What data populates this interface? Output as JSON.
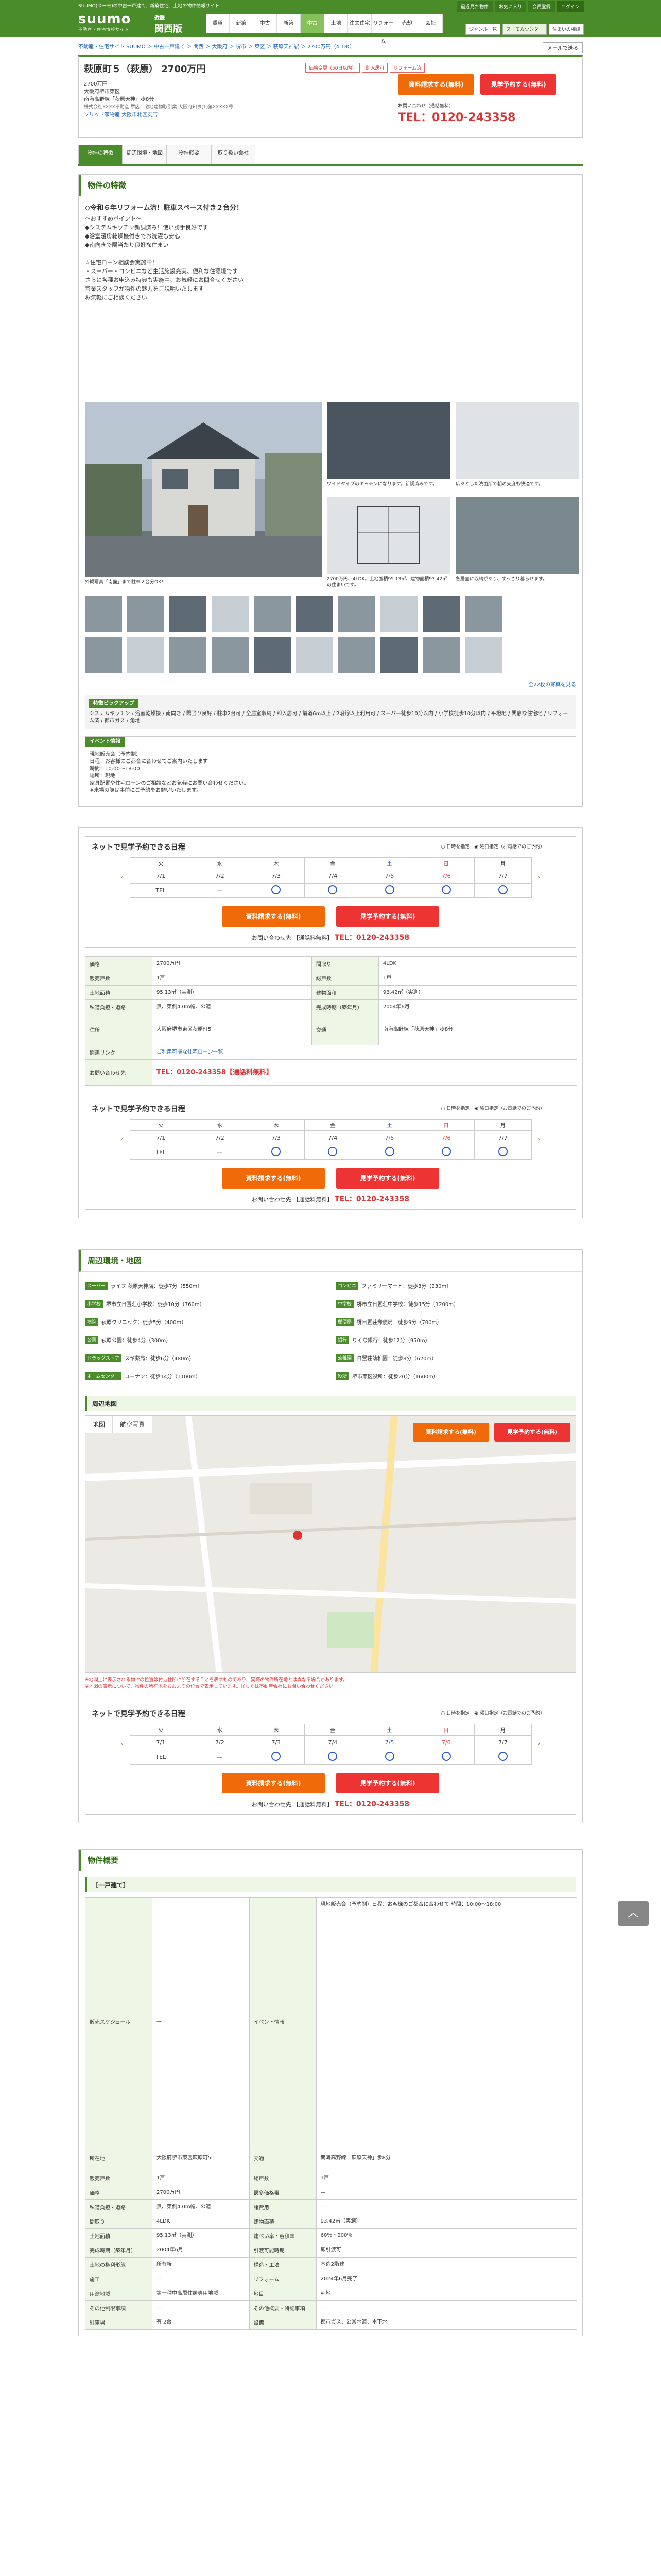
{
  "header": {
    "tagline": "SUUMO(スーモ)の中古一戸建て、新築住宅、土地の物件情報サイト",
    "logo": "suumo",
    "logo_sub": "不動産・住宅情報サイト",
    "region_label": "近畿",
    "region": "関西版",
    "links": [
      "最近見た物件",
      "お気に入り",
      "会員登録",
      "ログイン"
    ],
    "nav": [
      "賃貸",
      "新築マンション",
      "中古マンション",
      "新築一戸建て",
      "中古一戸建て",
      "土地",
      "注文住宅",
      "リフォーム",
      "売却査定",
      "不動産会社"
    ],
    "nav_short": [
      "賃貸",
      "新築",
      "中古",
      "新築",
      "中古",
      "土地",
      "注文住宅",
      "リフォーム",
      "売却",
      "会社"
    ],
    "nav_active": 4,
    "right_links": [
      "ジャンル一覧",
      "スーモカウンター",
      "住まいの相談"
    ]
  },
  "breadcrumb": "不動産・住宅サイト SUUMO ＞ 中古一戸建て ＞ 関西 ＞ 大阪府 ＞ 堺市 ＞ 東区 ＞ 萩原天神駅 ＞ 2700万円（4LDK）",
  "mail_button": "メールで送る",
  "property": {
    "title": "萩原町５（萩原） 2700万円",
    "labels": [
      "価格変更（50日以内）",
      "即入居可",
      "リフォーム済"
    ],
    "price": "2700万円",
    "address": "大阪府堺市東区",
    "station": "南海高野線「萩原天神」歩8分",
    "company_line": "株式会社XXXX不動産 堺店　宅地建物取引業 大阪府知事(1)第XXXXX号",
    "company_link": "ソリッド家物産 大阪市北区支店",
    "req_button": "資料請求する(無料)",
    "visit_button": "見学予約する(無料)",
    "tel_note": "お問い合わせ（通話無料）",
    "tel": "TEL：0120-243358"
  },
  "tabs": [
    "物件の特徴",
    "周辺環境・地図",
    "物件概要",
    "取り扱い会社"
  ],
  "feature": {
    "heading": "物件の特徴",
    "catch": "◇令和６年リフォーム済！駐車スペース付き２台分！",
    "lines": [
      "～おすすめポイント～",
      "◆システムキッチン新調済み！使い勝手良好です",
      "◆浴室暖房乾燥機付きでお洗濯も安心",
      "◆南向きで陽当たり良好な住まい",
      "",
      "☆住宅ローン相談会実施中！",
      "・スーパー・コンビニなど生活施設充実、便利な住環境です",
      "さらに各種お申込み特典も実施中。お気軽にお問合せください",
      "営業スタッフが物件の魅力をご説明いたします",
      "お気軽にご相談ください"
    ]
  },
  "gallery": {
    "caps": [
      "外観写真「南面」まで駐車２台分OK！",
      "ワイドタイプのキッチンになります。新調済みです。",
      "広々とした洗面所で朝の支度も快適です。",
      "2700万円、4LDK。土地面積95.13㎡、建物面積93.42㎡の住まいです。",
      "各居室に収納があり、すっきり暮らせます。"
    ],
    "more": "全22枚の写真を見る"
  },
  "pickup": {
    "label": "特徴ピックアップ",
    "text": "システムキッチン / 浴室乾燥機 / 南向き / 陽当り良好 / 駐車2台可 / 全居室収納 / 即入居可 / 前道6m以上 / 2沿線以上利用可 / スーパー徒歩10分以内 / 小学校徒歩10分以内 / 平坦地 / 閑静な住宅地 / リフォーム済 / 都市ガス / 角地"
  },
  "event": {
    "label": "イベント情報",
    "lines": [
      "現地販売会（予約制）",
      "日程：お客様のご都合に合わせてご案内いたします",
      "時間：10:00～18:00",
      "場所：現地",
      "家具配置や住宅ローンのご相談などお気軽にお問い合わせください。",
      "※来場の際は事前にご予約をお願いいたします。"
    ]
  },
  "calendar": {
    "title": "ネットで見学予約できる日程",
    "radio1": "日時を指定",
    "radio2": "曜日指定（お電話でのご予約）",
    "dows": [
      "火",
      "水",
      "木",
      "金",
      "土",
      "日",
      "月"
    ],
    "dates": [
      "7/1",
      "7/2",
      "7/3",
      "7/4",
      "7/5",
      "7/6",
      "7/7"
    ],
    "tel_label": "TEL",
    "dash": "—",
    "req_button": "資料請求する(無料)",
    "visit_button": "見学予約する(無料)",
    "tel_text": "お問い合わせ先",
    "tel_label2": "【通話料無料】",
    "tel": "TEL：0120-243358"
  },
  "summary_rows": [
    [
      "価格",
      "2700万円",
      "間取り",
      "4LDK"
    ],
    [
      "販売戸数",
      "1戸",
      "総戸数",
      "1戸"
    ],
    [
      "土地面積",
      "95.13㎡（実測）",
      "建物面積",
      "93.42㎡（実測）"
    ],
    [
      "私道負担・道路",
      "無、東側4.0m幅、公道",
      "完成時期（築年月）",
      "2004年6月"
    ],
    [
      "住所",
      "大阪府堺市東区萩原町5",
      "交通",
      "南海高野線「萩原天神」歩8分"
    ],
    [
      "関連リンク",
      "ご利用可能な住宅ローン一覧",
      "",
      ""
    ],
    [
      "お問い合わせ先",
      "TEL：0120-243358【通話料無料】",
      "",
      ""
    ]
  ],
  "surroundings": {
    "heading": "周辺環境・地図",
    "items": [
      [
        "スーパー",
        "ライフ 萩原天神店：徒歩7分（550m）"
      ],
      [
        "コンビニ",
        "ファミリーマート：徒歩3分（230m）"
      ],
      [
        "小学校",
        "堺市立日置荘小学校：徒歩10分（760m）"
      ],
      [
        "中学校",
        "堺市立日置荘中学校：徒歩15分（1200m）"
      ],
      [
        "病院",
        "萩原クリニック：徒歩5分（400m）"
      ],
      [
        "郵便局",
        "堺日置荘郵便局：徒歩9分（700m）"
      ],
      [
        "公園",
        "萩原公園：徒歩4分（300m）"
      ],
      [
        "銀行",
        "りそな銀行：徒歩12分（950m）"
      ],
      [
        "ドラッグストア",
        "スギ薬局：徒歩6分（480m）"
      ],
      [
        "幼稚園",
        "日置荘幼稚園：徒歩8分（620m）"
      ],
      [
        "ホームセンター",
        "コーナン：徒歩14分（1100m）"
      ],
      [
        "役所",
        "堺市東区役所：徒歩20分（1600m）"
      ]
    ]
  },
  "map": {
    "heading": "周辺地図",
    "tab1": "地図",
    "tab2": "航空写真",
    "req_button": "資料請求する(無料)",
    "visit_button": "見学予約する(無料)",
    "notes": [
      "※地図上に表示される物件の位置は付近住所に所在することを表すものであり、実際の物件所在地とは異なる場合があります。",
      "※地図の表示について、物件の所在地をおおよその位置で表示しています。詳しくは不動産会社にお問い合わせください。"
    ]
  },
  "overview": {
    "heading": "物件概要",
    "sub": "［一戸建て］",
    "rows": [
      [
        "販売スケジュール",
        "—",
        "イベント情報",
        "現地販売会（予約制）日程：お客様のご都合に合わせて 時間：10:00～18:00"
      ],
      [
        "所在地",
        "大阪府堺市東区萩原町5",
        "交通",
        "南海高野線「萩原天神」歩8分"
      ],
      [
        "販売戸数",
        "1戸",
        "総戸数",
        "1戸"
      ],
      [
        "価格",
        "2700万円",
        "最多価格帯",
        "—"
      ],
      [
        "私道負担・道路",
        "無、東側4.0m幅、公道",
        "諸費用",
        "—"
      ],
      [
        "間取り",
        "4LDK",
        "建物面積",
        "93.42㎡（実測）"
      ],
      [
        "土地面積",
        "95.13㎡（実測）",
        "建ぺい率・容積率",
        "60％・200％"
      ],
      [
        "完成時期（築年月）",
        "2004年6月",
        "引渡可能時期",
        "即引渡可"
      ],
      [
        "土地の権利形態",
        "所有権",
        "構造・工法",
        "木造2階建"
      ],
      [
        "施工",
        "—",
        "リフォーム",
        "2024年6月完了"
      ],
      [
        "用途地域",
        "第一種中高層住居専用地域",
        "地目",
        "宅地"
      ],
      [
        "その他制限事項",
        "—",
        "その他概要・特記事項",
        "—"
      ],
      [
        "駐車場",
        "有 2台",
        "設備",
        "都市ガス、公営水道、本下水"
      ]
    ]
  },
  "colors": {
    "brand": "#4a8c2a",
    "request": "#f06a0a",
    "visit": "#e33",
    "tel": "#d33"
  }
}
